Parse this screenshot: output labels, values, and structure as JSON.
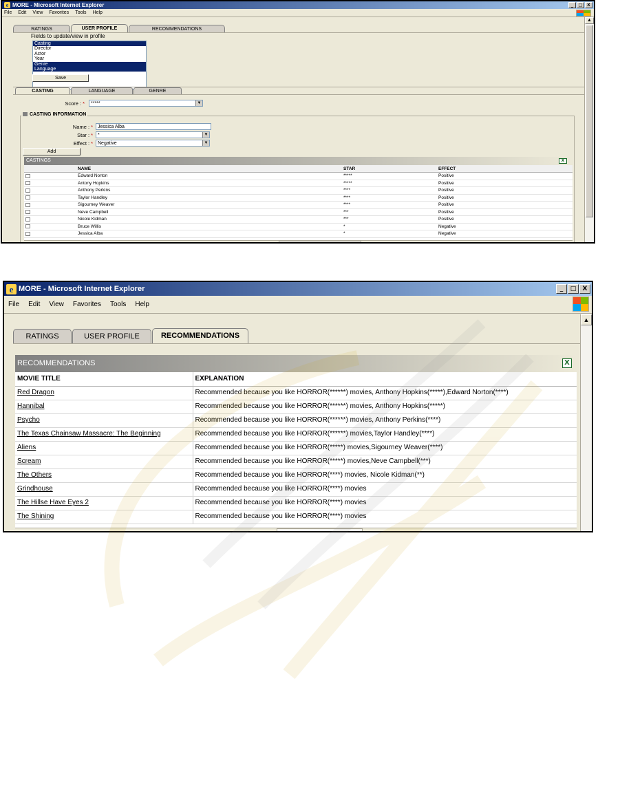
{
  "window_top": {
    "title": "MORE - Microsoft Internet Explorer",
    "minimize": "_",
    "maximize": "□",
    "close": "X",
    "menu": [
      "File",
      "Edit",
      "View",
      "Favorites",
      "Tools",
      "Help"
    ],
    "tabs": [
      "RATINGS",
      "USER PROFILE",
      "RECOMMENDATIONS"
    ],
    "active_tab": "USER PROFILE",
    "fields_label": "Fields to update/view in profile",
    "fields_list": [
      "Casting",
      "Director",
      "Actor",
      "Year",
      "Genre",
      "Language"
    ],
    "fields_selected": [
      "Casting",
      "Genre",
      "Language"
    ],
    "save_label": "Save",
    "sub_tabs": [
      "CASTING",
      "LANGUAGE",
      "GENRE"
    ],
    "active_sub_tab": "CASTING",
    "score_label": "Score :",
    "score_value": "*****",
    "section_title": "CASTING INFORMATION",
    "name_label": "Name :",
    "name_value": "Jessica Alba",
    "star_label": "Star :",
    "star_value": "*",
    "effect_label": "Effect :",
    "effect_value": "Negative",
    "add_label": "Add",
    "grid_title": "CASTINGS",
    "columns": [
      "NAME",
      "STAR",
      "EFFECT"
    ],
    "rows": [
      {
        "name": "Edward Norton",
        "star": "*****",
        "effect": "Positive"
      },
      {
        "name": "Antony Hopkins",
        "star": "*****",
        "effect": "Positive"
      },
      {
        "name": "Anthony Perkins",
        "star": "****",
        "effect": "Positive"
      },
      {
        "name": "Taylor Handley",
        "star": "****",
        "effect": "Positive"
      },
      {
        "name": "Sigourney Weaver",
        "star": "****",
        "effect": "Positive"
      },
      {
        "name": "Neve Campbell",
        "star": "***",
        "effect": "Positive"
      },
      {
        "name": "Nicole Kidman",
        "star": "***",
        "effect": "Positive"
      },
      {
        "name": "Bruce Willis",
        "star": "*",
        "effect": "Negative"
      },
      {
        "name": "Jessica Alba",
        "star": "*",
        "effect": "Negative"
      }
    ]
  },
  "window_bottom": {
    "title": "MORE - Microsoft Internet Explorer",
    "minimize": "_",
    "maximize": "□",
    "close": "X",
    "menu": [
      "File",
      "Edit",
      "View",
      "Favorites",
      "Tools",
      "Help"
    ],
    "tabs": [
      "RATINGS",
      "USER PROFILE",
      "RECOMMENDATIONS"
    ],
    "active_tab": "RECOMMENDATIONS",
    "grid_title": "RECOMMENDATIONS",
    "columns": [
      "MOVIE TITLE",
      "EXPLANATION"
    ],
    "rows": [
      {
        "title": "Red Dragon",
        "explanation": "Recommended because you like HORROR(******) movies, Anthony Hopkins(*****),Edward Norton(****)"
      },
      {
        "title": "Hannibal",
        "explanation": "Recommended because you like HORROR(******) movies, Anthony Hopkins(*****)"
      },
      {
        "title": "Psycho",
        "explanation": "Recommended because you like HORROR(******) movies, Anthony Perkins(****)"
      },
      {
        "title": "The Texas Chainsaw Massacre: The Beginning",
        "explanation": "Recommended because you like HORROR(******) movies,Taylor Handley(****)"
      },
      {
        "title": "Aliens",
        "explanation": "Recommended because you like HORROR(*****) movies,Sigourney Weaver(****)"
      },
      {
        "title": "Scream",
        "explanation": "Recommended because you like HORROR(*****) movies,Neve Campbell(***)"
      },
      {
        "title": "The Others",
        "explanation": "Recommended because you like HORROR(****) movies, Nicole Kidman(**)"
      },
      {
        "title": "Grindhouse",
        "explanation": "Recommended because you like HORROR(****) movies"
      },
      {
        "title": "The Hillse Have Eyes 2",
        "explanation": "Recommended because you like HORROR(****) movies"
      },
      {
        "title": "The Shining",
        "explanation": "Recommended because you like HORROR(****) movies"
      }
    ]
  },
  "colors": {
    "titlebar": "#0a246a",
    "window_face": "#ece9d8",
    "selection": "#0a246a",
    "required_marker": "#c00000",
    "excel_icon": "#1b6b2b"
  },
  "icons": {
    "ie": "ie-icon",
    "windows_logo": "windows-logo-icon",
    "excel_export": "excel-export-icon"
  }
}
